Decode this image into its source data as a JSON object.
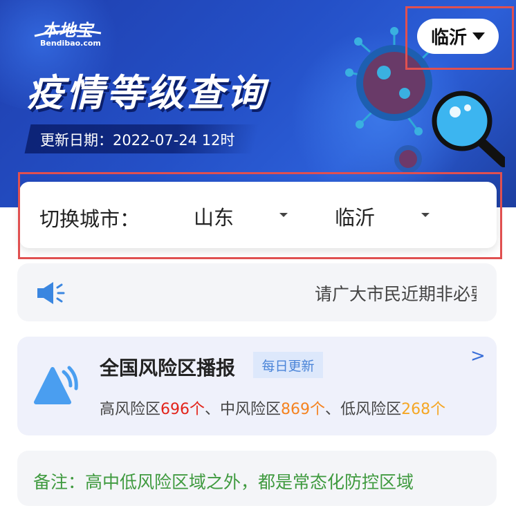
{
  "header": {
    "logo_text": "本地宝",
    "logo_sub": "Bendibao.com",
    "title": "疫情等级查询",
    "update_text": "更新日期：2022-07-24 12时",
    "city_button": "临沂"
  },
  "city_switch": {
    "label": "切换城市：",
    "province": "山东",
    "city": "临沂"
  },
  "notice": {
    "text": "请广大市民近期非必要"
  },
  "risk_report": {
    "title": "全国风险区播报",
    "tag": "每日更新",
    "arrow": ">",
    "high_label": "高风险区",
    "high_count": "696个",
    "sep1": "、",
    "mid_label": "中风险区",
    "mid_count": "869个",
    "sep2": "、",
    "low_label": "低风险区",
    "low_count": "268个"
  },
  "remark": {
    "text": "备注：高中低风险区域之外，都是常态化防控区域"
  },
  "colors": {
    "banner": "#2450c7",
    "highlight": "#e05050",
    "high": "#e2231a",
    "mid": "#f5821f",
    "low": "#f5a623",
    "remark": "#3f9a3f"
  }
}
